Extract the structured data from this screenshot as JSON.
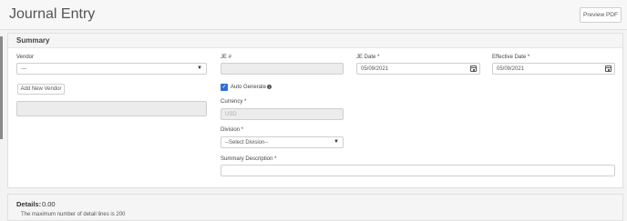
{
  "header": {
    "title": "Journal Entry",
    "preview_pdf_label": "Preview PDF"
  },
  "summary": {
    "title": "Summary",
    "vendor": {
      "label": "Vendor",
      "value": "---",
      "add_button_label": "Add New Vendor"
    },
    "je_number": {
      "label": "JE #",
      "value": ""
    },
    "auto_generate": {
      "label": "Auto Generate",
      "checked": true
    },
    "currency": {
      "label": "Currency *",
      "value": "USD"
    },
    "division": {
      "label": "Division *",
      "value": "--Select Division--"
    },
    "summary_description": {
      "label": "Summary Description *",
      "value": ""
    },
    "je_date": {
      "label": "JE Date *",
      "value": "05/09/2021"
    },
    "effective_date": {
      "label": "Effective Date *",
      "value": "05/09/2021"
    }
  },
  "details": {
    "label": "Details:",
    "value": "0.00",
    "note": "The maximum number of detail lines is 200"
  },
  "icons": {
    "checkbox": "check-icon",
    "info": "info-icon",
    "calendar": "calendar-icon",
    "dropdown": "chevron-down-icon"
  },
  "colors": {
    "checkbox_accent": "#2d6fd6"
  }
}
